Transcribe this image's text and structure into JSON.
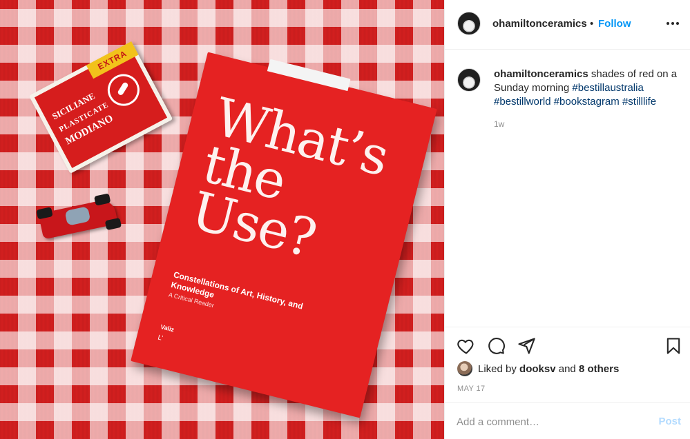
{
  "post": {
    "username": "ohamiltonceramics",
    "separator": "•",
    "follow_label": "Follow",
    "caption": {
      "username": "ohamiltonceramics",
      "text": " shades of red on a Sunday morning ",
      "hashtags": [
        "#bestillaustralia",
        "#bestillworld",
        "#bookstagram",
        "#stilllife"
      ]
    },
    "age": "1w",
    "likes": {
      "prefix": "Liked by ",
      "user": "dooksv",
      "middle": " and ",
      "others": "8 others"
    },
    "date": "MAY 17",
    "comment": {
      "placeholder": "Add a comment…",
      "post_label": "Post"
    }
  },
  "photo": {
    "card_box": {
      "extra": "EXTRA",
      "line1": "SICILIANE",
      "line2": "PLASTICATE",
      "line3": "MODIANO"
    },
    "book": {
      "title": "What’s the Use?",
      "subtitle": "Constellations of Art, History, and Knowledge",
      "reader": "A Critical Reader",
      "publisher": "Valiz",
      "pub_mark": "L’"
    }
  },
  "colors": {
    "link": "#0095f6",
    "hashtag": "#00376b",
    "muted": "#8e8e8e",
    "post_disabled": "#b3dbff"
  },
  "icons": [
    "more-options-icon",
    "heart-icon",
    "comment-icon",
    "share-icon",
    "bookmark-icon"
  ]
}
